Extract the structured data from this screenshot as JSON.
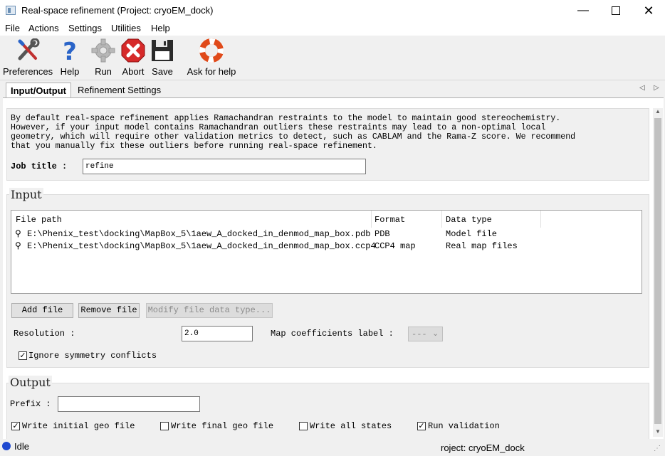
{
  "window": {
    "title": "Real-space refinement (Project: cryoEM_dock)"
  },
  "menu": [
    "File",
    "Actions",
    "Settings",
    "Utilities",
    "Help"
  ],
  "toolbar": {
    "preferences": "Preferences",
    "help": "Help",
    "run": "Run",
    "abort": "Abort",
    "save": "Save",
    "ask_for_help": "Ask for help"
  },
  "tabs": [
    "Input/Output",
    "Refinement Settings"
  ],
  "info_text": "By default real-space refinement applies Ramachandran restraints to the model to maintain good stereochemistry.\nHowever, if your input model contains Ramachandran outliers these restraints may lead to a non-optimal local\ngeometry, which will require other validation metrics to detect, such as CABLAM and the Rama-Z score. We recommend\nthat you manually fix these outliers before running real-space refinement.",
  "job_title": {
    "label": "Job title :",
    "value": "refine"
  },
  "input": {
    "legend": "Input",
    "columns": [
      "File path",
      "Format",
      "Data type"
    ],
    "rows": [
      {
        "path": "E:\\Phenix_test\\docking\\MapBox_5\\1aew_A_docked_in_denmod_map_box.pdb",
        "format": "PDB",
        "type": "Model file"
      },
      {
        "path": "E:\\Phenix_test\\docking\\MapBox_5\\1aew_A_docked_in_denmod_map_box.ccp4",
        "format": "CCP4 map",
        "type": "Real map files"
      }
    ],
    "add_file": "Add file",
    "remove_file": "Remove file",
    "modify_file": "Modify file data type...",
    "resolution_label": "Resolution :",
    "resolution_value": "2.0",
    "map_coeff_label": "Map coefficients label :",
    "map_coeff_value": "---",
    "ignore_symmetry": "Ignore symmetry conflicts"
  },
  "output": {
    "legend": "Output",
    "prefix_label": "Prefix :",
    "prefix_value": "",
    "write_initial_geo": "Write initial geo file",
    "write_final_geo": "Write final geo file",
    "write_all_states": "Write all states",
    "run_validation": "Run validation"
  },
  "status": {
    "state": "Idle",
    "project": "roject: cryoEM_dock"
  },
  "colors": {
    "abort_red": "#d62a2a",
    "help_blue": "#2a64c8",
    "status_blue": "#1f49d0"
  }
}
